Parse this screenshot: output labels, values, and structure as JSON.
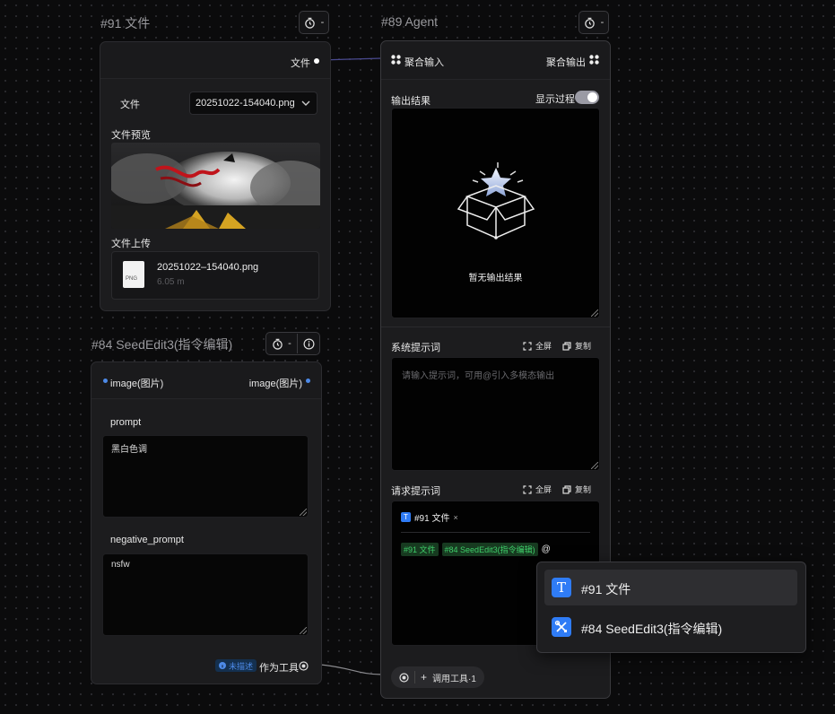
{
  "nodes": {
    "file_node": {
      "title": "#91 文件",
      "output_port": "文件",
      "file_label": "文件",
      "file_select": "20251022-154040.png",
      "preview_label": "文件预览",
      "upload_label": "文件上传",
      "upload_file_name": "20251022–154040.png",
      "upload_file_size": "6.05 m",
      "file_type_badge": "PNG"
    },
    "seededit_node": {
      "title": "#84 SeedEdit3(指令编辑)",
      "input_port": "image(图片)",
      "output_port": "image(图片)",
      "prompt_label": "prompt",
      "prompt_value": "黑白色调",
      "negative_label": "negative_prompt",
      "negative_value": "nsfw",
      "status_badge": "未描述",
      "as_tool_label": "作为工具"
    },
    "agent_node": {
      "title": "#89 Agent",
      "aggregate_input": "聚合输入",
      "aggregate_output": "聚合输出",
      "output_result_label": "输出结果",
      "show_process_label": "显示过程",
      "show_process_on": true,
      "empty_text": "暂无输出结果",
      "system_prompt_label": "系统提示词",
      "fullscreen_label": "全屏",
      "copy_label": "复制",
      "system_prompt_placeholder": "请输入提示词，可用@引入多模态输出",
      "request_prompt_label": "请求提示词",
      "attached_chip": "#91 文件",
      "inline_tag_1": "#91 文件",
      "inline_tag_2": "#84 SeedEdit3(指令编辑)",
      "at_symbol": "@",
      "call_tool_label": "调用工具·1"
    }
  },
  "mention_dropdown": {
    "items": [
      {
        "label": "#91 文件",
        "icon": "text-icon"
      },
      {
        "label": "#84 SeedEdit3(指令编辑)",
        "icon": "tools-icon"
      }
    ]
  },
  "header_btn": {
    "dash": "-"
  },
  "colors": {
    "accent_blue": "#2f7cf6",
    "tag_green": "#3fcf6a",
    "card_bg": "#1c1c1e",
    "canvas_bg": "#0b0b0c"
  }
}
